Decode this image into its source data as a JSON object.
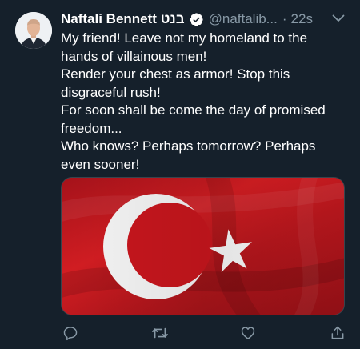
{
  "tweet": {
    "display_name": "Naftali Bennett בנט",
    "handle": "@naftalib...",
    "separator": "·",
    "time": "22s",
    "text_lines": [
      "My friend! Leave not my homeland to the",
      "hands of villainous men!",
      "Render your chest as armor! Stop this",
      "disgraceful rush!",
      "For soon shall be come the day of promised",
      "freedom...",
      "Who knows? Perhaps tomorrow? Perhaps",
      "even sooner!"
    ]
  },
  "icons": {
    "more": "chevron-down-icon",
    "verified": "verified-badge-icon",
    "reply": "reply-icon",
    "retweet": "retweet-icon",
    "like": "heart-icon",
    "share": "share-icon"
  },
  "colors": {
    "background": "#15202b",
    "text": "#ffffff",
    "secondary_text": "#8899a6",
    "verified": "#ffffff",
    "flag_red": "#c8161d"
  }
}
